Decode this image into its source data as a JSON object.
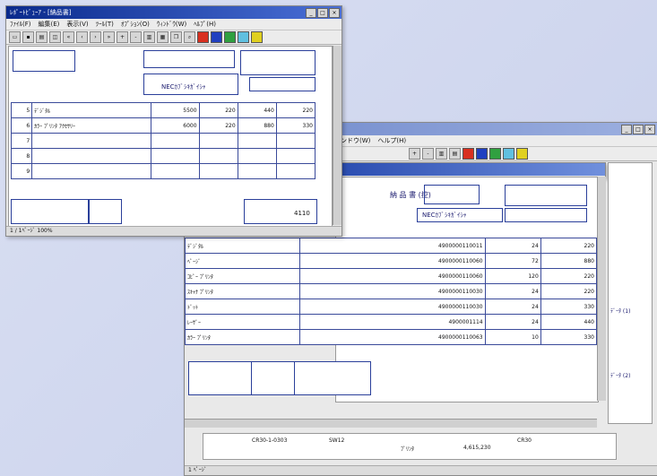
{
  "back_window": {
    "menu": [
      "ウィンドウ(W)",
      "ヘルプ(H)"
    ],
    "doc_title": "納 品 書 (控)",
    "customer": "NECｶﾌﾞｼｷｶﾞｲｼｬ",
    "rows": [
      {
        "name": "ﾃﾞｼﾞﾀﾙ",
        "code": "4900000110011",
        "qty": "24",
        "price": "220"
      },
      {
        "name": "ﾍﾟｰｼﾞ",
        "code": "4900000110060",
        "qty": "72",
        "price": "880"
      },
      {
        "name": "ｺﾋﾟｰ ﾌﾟﾘﾝﾀ",
        "code": "4900000110060",
        "qty": "120",
        "price": "220"
      },
      {
        "name": "ｽｷｬﾅ ﾌﾟﾘﾝﾀ",
        "code": "4900000110030",
        "qty": "24",
        "price": "220"
      },
      {
        "name": "ﾄﾞｯﾄ",
        "code": "4900000110030",
        "qty": "24",
        "price": "330"
      },
      {
        "name": "ﾚｰｻﾞｰ",
        "code": "4900001114",
        "qty": "24",
        "price": "440"
      },
      {
        "name": "ｶﾗｰ ﾌﾟﾘﾝﾀ",
        "code": "4900000110063",
        "qty": "10",
        "price": "330"
      }
    ],
    "footer": [
      "CR30-1-0303",
      "SW12",
      "ﾌﾟﾘﾝﾀ",
      "4,615,230",
      "CR30"
    ],
    "side_labels": [
      "ﾃﾞｰﾀ (1)",
      "ﾃﾞｰﾀ (2)"
    ],
    "status": "1 ﾍﾟｰｼﾞ"
  },
  "front_window": {
    "title": "ﾚﾎﾟｰﾄﾋﾞｭｰｱ - [納品書]",
    "menu": [
      "ﾌｧｲﾙ(F)",
      "編集(E)",
      "表示(V)",
      "ﾂｰﾙ(T)",
      "ｵﾌﾟｼｮﾝ(O)",
      "ｳｨﾝﾄﾞｳ(W)",
      "ﾍﾙﾌﾟ(H)"
    ],
    "customer": "NECｶﾌﾞｼｷｶﾞｲｼｬ",
    "rows": [
      {
        "num": "5",
        "name": "ﾃﾞｼﾞﾀﾙ",
        "amount": "5500",
        "col1": "220",
        "col2": "440",
        "col3": "220"
      },
      {
        "num": "6",
        "name": "ｶﾗｰ ﾌﾟﾘﾝﾀ ｱｸｾｻﾘｰ",
        "amount": "6000",
        "col1": "220",
        "col2": "880",
        "col3": "330"
      },
      {
        "num": "7",
        "name": "",
        "amount": "",
        "col1": "",
        "col2": "",
        "col3": ""
      },
      {
        "num": "8",
        "name": "",
        "amount": "",
        "col1": "",
        "col2": "",
        "col3": ""
      },
      {
        "num": "9",
        "name": "",
        "amount": "",
        "col1": "",
        "col2": "",
        "col3": ""
      }
    ],
    "total": "4110",
    "status": "1 / 1ﾍﾟｰｼﾞ 100%"
  },
  "colors": {
    "swatches": [
      "#d83020",
      "#2040c0",
      "#30a040",
      "#60c0e0",
      "#e0d020"
    ]
  }
}
